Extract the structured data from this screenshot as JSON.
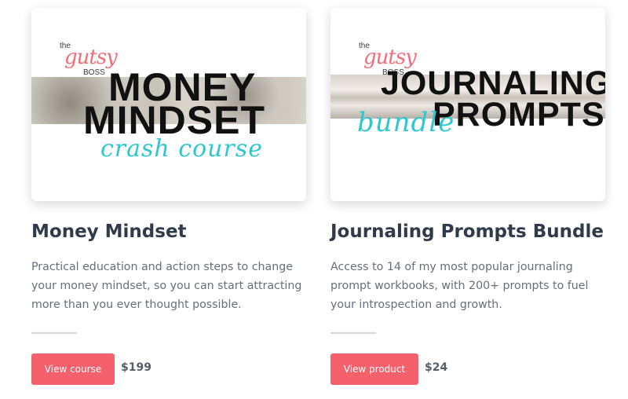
{
  "products": [
    {
      "id": "money-mindset",
      "title": "Money Mindset",
      "description": "Practical education and action steps to change your money mindset, so you can start attracting more than you ever thought possible.",
      "button_label": "View course",
      "price": "$199",
      "thumbnail": {
        "brand_the": "the",
        "brand_script": "gutsy",
        "brand_boss": "BOSS",
        "line1": "MONEY",
        "line2": "MINDSET",
        "line3": "crash course"
      }
    },
    {
      "id": "journaling-prompts-bundle",
      "title": "Journaling Prompts Bundle",
      "description": "Access to 14 of my most popular journaling prompt workbooks, with 200+ prompts to fuel your introspection and growth.",
      "button_label": "View product",
      "price": "$24",
      "thumbnail": {
        "brand_the": "the",
        "brand_script": "gutsy",
        "brand_boss": "BOSS",
        "line1": "JOURNALING",
        "line2": "PROMPTS",
        "line3": "bundle"
      }
    }
  ],
  "colors": {
    "button_bg": "#f4606c",
    "title_text": "#2f3b4a",
    "body_text": "#666f78",
    "accent_teal": "#2dc7cf",
    "accent_pink": "#f26d78"
  }
}
